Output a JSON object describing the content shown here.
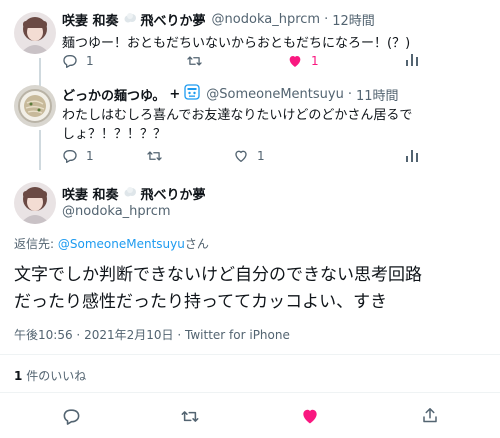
{
  "tweet1": {
    "name": "咲妻 和奏",
    "name_suffix": "飛べりか夢",
    "handle": "@nodoka_hprcm",
    "sep": "·",
    "time": "12時間",
    "text": "麺つゆー！おともだちいないからおともだちになろー！(？)",
    "reply_count": "1",
    "like_count": "1"
  },
  "tweet2": {
    "name": "どっかの麺つゆ。",
    "name_plus": "+",
    "handle": "@SomeoneMentsuyu",
    "sep": "·",
    "time": "11時間",
    "text_line1": "わたしはむしろ喜んでお友達なりたいけどのどかさん居るで",
    "text_line2": "しょ？！？！？？",
    "reply_count": "1",
    "like_count": "1"
  },
  "main": {
    "name": "咲妻 和奏",
    "name_suffix": "飛べりか夢",
    "handle": "@nodoka_hprcm",
    "reply_to_prefix": "返信先: ",
    "reply_to_handle": "@SomeoneMentsuyu",
    "reply_to_suffix": "さん",
    "text_line1": "文字でしか判断できないけど自分のできない思考回路",
    "text_line2": "だったり感性だったり持っててカッコよい、すき",
    "meta_time": "午後10:56",
    "meta_date": "2021年2月10日",
    "meta_source": "Twitter for iPhone",
    "meta_sep": "·",
    "likes_count": "1",
    "likes_label": "件のいいね"
  },
  "colors": {
    "like_red": "#f91880",
    "link_blue": "#1d9bf0",
    "gray": "#536471"
  }
}
